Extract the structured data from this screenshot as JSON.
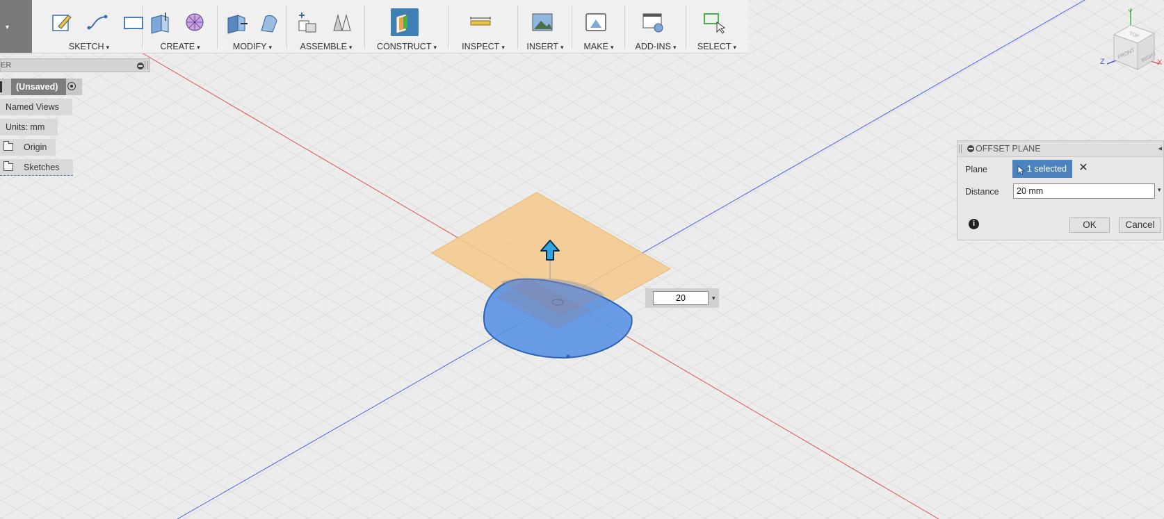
{
  "toolbar": {
    "groups": [
      {
        "label": "SKETCH",
        "icons": [
          "create-sketch-icon",
          "line-icon",
          "rectangle-icon"
        ]
      },
      {
        "label": "CREATE",
        "icons": [
          "extrude-icon",
          "form-icon"
        ]
      },
      {
        "label": "MODIFY",
        "icons": [
          "press-pull-icon",
          "fillet-icon"
        ]
      },
      {
        "label": "ASSEMBLE",
        "icons": [
          "new-component-icon",
          "joint-icon"
        ]
      },
      {
        "label": "CONSTRUCT",
        "icons": [
          "offset-plane-icon"
        ]
      },
      {
        "label": "INSPECT",
        "icons": [
          "measure-icon"
        ]
      },
      {
        "label": "INSERT",
        "icons": [
          "insert-image-icon"
        ]
      },
      {
        "label": "MAKE",
        "icons": [
          "3d-print-icon"
        ]
      },
      {
        "label": "ADD-INS",
        "icons": [
          "scripts-addins-icon"
        ]
      },
      {
        "label": "SELECT",
        "icons": [
          "select-icon"
        ]
      }
    ],
    "dropdown_glyph": "▾"
  },
  "browser": {
    "title_fragment": "ER",
    "document_label": "(Unsaved)",
    "nodes": [
      "Named Views",
      "Units: mm",
      "Origin",
      "Sketches"
    ]
  },
  "dialog": {
    "title": "OFFSET PLANE",
    "plane_label": "Plane",
    "plane_value": "1 selected",
    "distance_label": "Distance",
    "distance_value": "20 mm",
    "ok_label": "OK",
    "cancel_label": "Cancel"
  },
  "manipulator": {
    "value": "20"
  },
  "viewcube": {
    "top": "TOP",
    "front": "FRONT",
    "right": "RIGHT",
    "y": "Y",
    "z": "Z",
    "x": "X"
  },
  "colors": {
    "accent": "#3e7fb6",
    "plane": "#f5c98a",
    "profile": "#5b93e6",
    "x_axis": "#e05050",
    "z_axis": "#4a5ee0"
  }
}
